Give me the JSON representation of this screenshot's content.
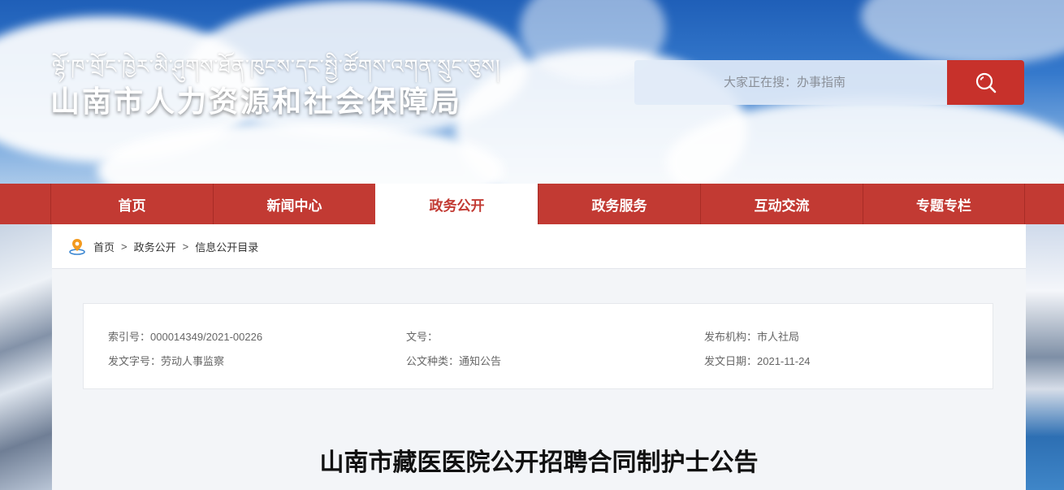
{
  "header": {
    "title_tibetan": "ལྷོ་ཁ་གྲོང་ཁྱེར་མི་ཤུགས་ཐོན་ཁུངས་དང་སྤྱི་ཚོགས་འགན་སྲུང་ཅུས།",
    "title_chinese": "山南市人力资源和社会保障局"
  },
  "search": {
    "placeholder": "大家正在搜：办事指南",
    "button_icon": "search-icon",
    "button_color": "#c7312b"
  },
  "nav": {
    "items": [
      {
        "label": "首页"
      },
      {
        "label": "新闻中心"
      },
      {
        "label": "政务公开"
      },
      {
        "label": "政务服务"
      },
      {
        "label": "互动交流"
      },
      {
        "label": "专题专栏"
      }
    ],
    "active_index": 2,
    "color": "#c23a33"
  },
  "breadcrumb": {
    "icon": "location-pin-icon",
    "items": [
      "首页",
      "政务公开",
      "信息公开目录"
    ],
    "separator": ">"
  },
  "meta": {
    "index_no": "索引号：000014349/2021-00226",
    "doc_no": "文号：",
    "publisher": "发布机构：市人社局",
    "issuing_dept": "发文字号：劳动人事监察",
    "doc_type": "公文种类：通知公告",
    "pub_date": "发文日期：2021-11-24"
  },
  "article": {
    "title": "山南市藏医医院公开招聘合同制护士公告"
  }
}
